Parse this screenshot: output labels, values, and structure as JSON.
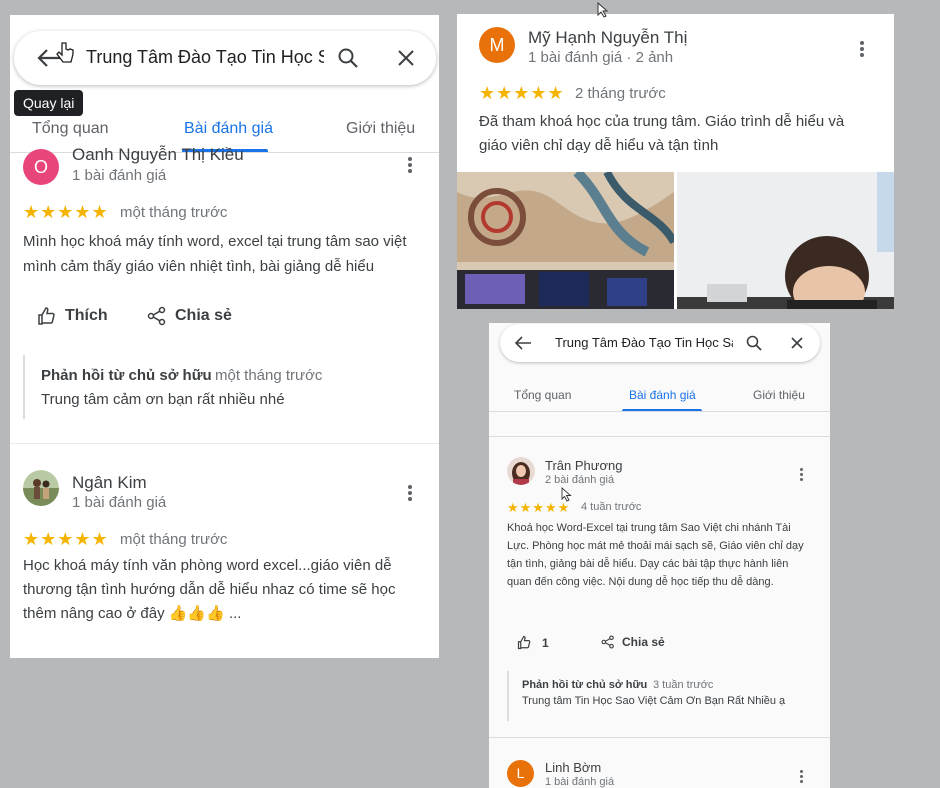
{
  "panel_left": {
    "search": {
      "value": "Trung Tâm Đào Tạo Tin Học Sa"
    },
    "tooltip": "Quay lại",
    "tabs": [
      "Tổng quan",
      "Bài đánh giá",
      "Giới thiệu"
    ],
    "reviews": [
      {
        "avatar_letter": "O",
        "avatar_color": "#e8457a",
        "name": "Oanh Nguyễn Thị Kiều",
        "meta": "1 bài đánh giá",
        "stars": "★★★★★",
        "time": "một tháng trước",
        "text": "Mình học khoá máy tính word, excel tại trung tâm sao việt mình cảm thấy giáo viên nhiệt tình, bài giảng dễ hiểu",
        "like_label": "Thích",
        "share_label": "Chia sẻ",
        "owner_title": "Phản hồi từ chủ sở hữu",
        "owner_time": "một tháng trước",
        "owner_text": "Trung tâm cảm ơn bạn rất nhiều nhé"
      },
      {
        "name": "Ngân Kim",
        "meta": "1 bài đánh giá",
        "stars": "★★★★★",
        "time": "một tháng trước",
        "text": "Học khoá máy tính văn phòng word excel...giáo viên dễ thương tận tình hướng dẫn dễ hiểu nhaz có time sẽ học thêm nâng cao ở đây 👍👍👍 ..."
      }
    ]
  },
  "panel_top_right": {
    "avatar_letter": "M",
    "avatar_color": "#e8710a",
    "name": "Mỹ Hạnh Nguyễn Thị",
    "meta": "1 bài đánh giá · 2 ảnh",
    "stars": "★★★★★",
    "time": "2 tháng trước",
    "text": "Đã tham khoá học của trung tâm. Giáo trình dễ hiểu và giáo viên chỉ dạy dễ hiểu và tận tình"
  },
  "panel_bottom_right": {
    "search": {
      "value": "Trung Tâm Đào Tạo Tin Học Sa"
    },
    "tabs": [
      "Tổng quan",
      "Bài đánh giá",
      "Giới thiệu"
    ],
    "review": {
      "name": "Trân Phương",
      "meta": "2 bài đánh giá",
      "stars": "★★★★★",
      "time": "4 tuần trước",
      "text": "Khoá học Word-Excel tại trung tâm Sao Việt chi nhánh Tài Lực. Phòng học mát mẻ thoải mái sạch sẽ, Giáo viên chỉ dạy tận tình, giảng bài dễ hiểu. Dạy các bài tập thực hành liên quan đến công việc. Nội dung dễ học tiếp thu dễ dàng.",
      "like_count": "1",
      "share_label": "Chia sẻ",
      "owner_title": "Phản hồi từ chủ sở hữu",
      "owner_time": "3 tuần trước",
      "owner_text": "Trung tâm Tin Học Sao Việt Cảm Ơn  Bạn Rất Nhiều ạ"
    },
    "next_review": {
      "avatar_letter": "L",
      "avatar_color": "#e8710a",
      "name": "Linh Bờm",
      "meta": "1 bài đánh giá"
    }
  },
  "colors": {
    "accent": "#1a73e8",
    "star": "#f4b400"
  }
}
